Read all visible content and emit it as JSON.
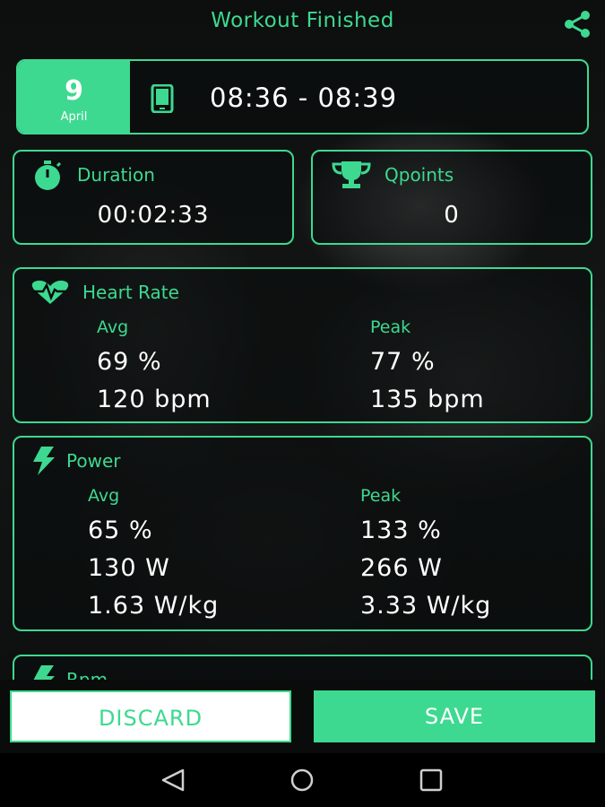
{
  "header": {
    "title": "Workout Finished",
    "share_icon": "share-icon"
  },
  "session": {
    "day": "9",
    "month": "April",
    "device_icon": "phone-icon",
    "time_range": "08:36 - 08:39"
  },
  "duration": {
    "label": "Duration",
    "value": "00:02:33",
    "icon": "stopwatch-icon"
  },
  "qpoints": {
    "label": "Qpoints",
    "value": "0",
    "icon": "trophy-icon"
  },
  "heart_rate": {
    "label": "Heart Rate",
    "icon": "heart-rate-icon",
    "avg_label": "Avg",
    "peak_label": "Peak",
    "avg_percent": "69 %",
    "peak_percent": "77 %",
    "avg_bpm": "120 bpm",
    "peak_bpm": "135 bpm"
  },
  "power": {
    "label": "Power",
    "icon": "lightning-icon",
    "avg_label": "Avg",
    "peak_label": "Peak",
    "avg_percent": "65 %",
    "peak_percent": "133 %",
    "avg_watts": "130 W",
    "peak_watts": "266 W",
    "avg_wkg": "1.63 W/kg",
    "peak_wkg": "3.33 W/kg"
  },
  "rpm": {
    "label": "Rpm",
    "icon": "lightning-icon"
  },
  "actions": {
    "discard": "DISCARD",
    "save": "SAVE"
  },
  "navigation": {
    "back_icon": "back-icon",
    "home_icon": "home-icon",
    "recents_icon": "recents-icon"
  },
  "colors": {
    "accent": "#3dd990",
    "background": "#0a0b0b",
    "text": "#ffffff"
  }
}
